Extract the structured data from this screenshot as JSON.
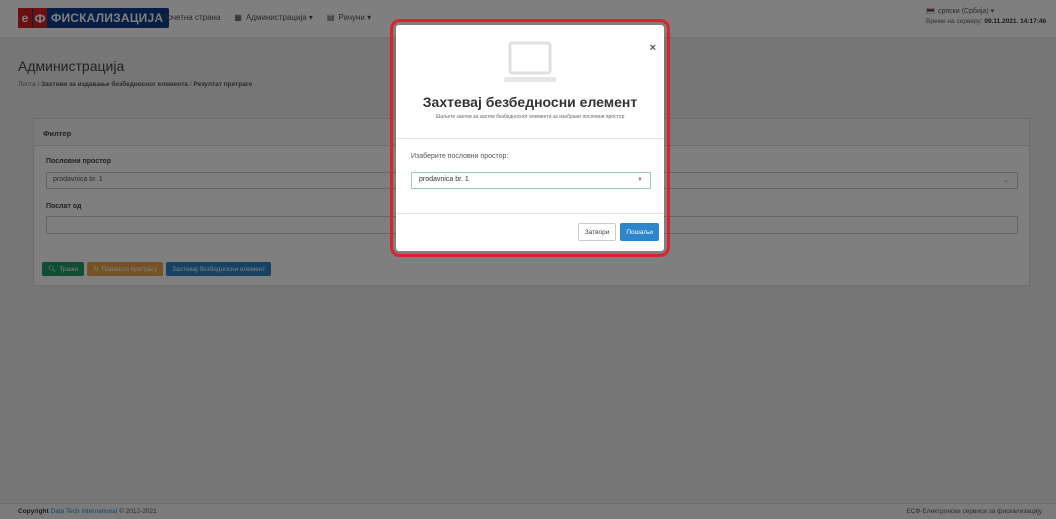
{
  "navbar": {
    "logo_prefix": "е",
    "logo_mark": "Ф",
    "logo_text": "ФИСКАЛИЗАЦИЈА",
    "items": [
      {
        "icon": "home-icon",
        "glyph": "⌂",
        "label": "Почетна страна"
      },
      {
        "icon": "table-icon",
        "glyph": "▦",
        "label": "Администрација ▾"
      },
      {
        "icon": "invoice-icon",
        "glyph": "▤",
        "label": "Рачуни ▾"
      }
    ],
    "language": "српски (Србија) ▾",
    "server_time_label": "Време на серверу:",
    "server_time_value": "09.11.2021. 14:17:46"
  },
  "header": {
    "title": "Администрација",
    "breadcrumb": [
      "Листа",
      "Захтеви за издавање безбедносног елемента",
      "Резултат претраге"
    ]
  },
  "filter": {
    "title": "Филтер",
    "business_space_label": "Пословни простор",
    "business_space_value": "prodavnica br. 1",
    "sent_by_label": "Послат од",
    "sent_by_value": "",
    "buttons": {
      "search": "Тражи",
      "reset": "Поништи претрагу",
      "request": "Захтевај безбедносни елемент"
    }
  },
  "footer": {
    "copyright_prefix": "Copyright",
    "company": "Data Tech International",
    "years": "© 2012-2021",
    "right": "ЕСФ-Електронски сервиси за фискализацију"
  },
  "modal": {
    "title": "Захтевај безбедносни елемент",
    "subtitle": "Шаљете захтев за захтев безбедносног елемента за изабрани пословни простор",
    "select_label": "Изаберите пословни простор:",
    "select_value": "prodavnica br. 1",
    "close_button": "Затвори",
    "send_button": "Пошаљи"
  },
  "colors": {
    "brand_blue": "#0d3c8c",
    "brand_red": "#d62020",
    "highlight_red": "#d9232e",
    "primary": "#2c86c9",
    "success": "#1e9b6b",
    "warning": "#e8a74e"
  }
}
